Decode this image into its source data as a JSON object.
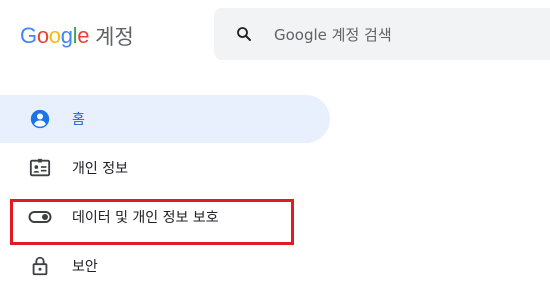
{
  "header": {
    "logo_letters": [
      {
        "ch": "G",
        "color": "#4285F4"
      },
      {
        "ch": "o",
        "color": "#EA4335"
      },
      {
        "ch": "o",
        "color": "#FBBC05"
      },
      {
        "ch": "g",
        "color": "#4285F4"
      },
      {
        "ch": "l",
        "color": "#34A853"
      },
      {
        "ch": "e",
        "color": "#EA4335"
      }
    ],
    "product_label": "계정",
    "search": {
      "placeholder": "Google 계정 검색",
      "icon": "search-icon"
    }
  },
  "sidebar": {
    "items": [
      {
        "label": "홈",
        "icon": "home-account-icon",
        "active": true
      },
      {
        "label": "개인 정보",
        "icon": "id-card-icon",
        "active": false
      },
      {
        "label": "데이터 및 개인 정보 보호",
        "icon": "toggle-icon",
        "active": false
      },
      {
        "label": "보안",
        "icon": "lock-icon",
        "active": false
      }
    ]
  },
  "annotation": {
    "highlight_color": "#E01B22"
  },
  "colors": {
    "active_bg": "#E8F0FE",
    "active_accent": "#1A73E8",
    "icon_gray": "#5F6368"
  }
}
